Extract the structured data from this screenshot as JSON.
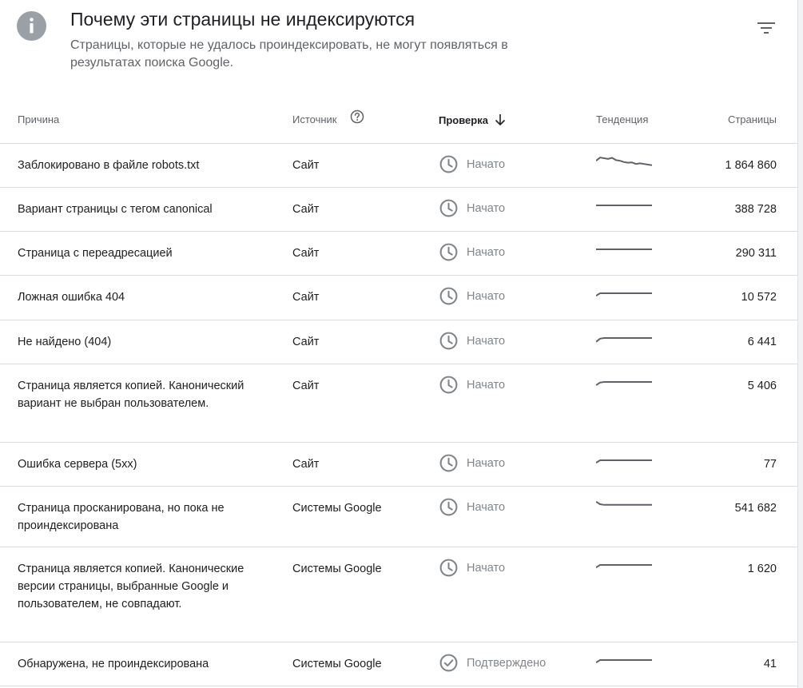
{
  "header": {
    "title": "Почему эти страницы не индексируются",
    "subtitle": "Страницы, которые не удалось проиндексировать, не могут появляться в результатах поиска Google.",
    "info_icon": "info-icon",
    "filter_icon": "filter-icon"
  },
  "columns": {
    "reason": "Причина",
    "source": "Источник",
    "check": "Проверка",
    "trend": "Тенденция",
    "pages": "Страницы"
  },
  "status_icons": {
    "started": "clock-icon",
    "confirmed": "check-circle-icon"
  },
  "colors": {
    "icon_grey": "#9aa0a6",
    "status_text": "#80868b",
    "sparkline": "#5f6368",
    "divider": "#dadce0"
  },
  "rows": [
    {
      "reason": "Заблокировано в файле robots.txt",
      "source": "Сайт",
      "check": "Начато",
      "status": "started",
      "pages": "1 864 860",
      "trend": [
        0.55,
        0.8,
        0.75,
        0.7,
        0.78,
        0.6,
        0.55,
        0.45,
        0.4,
        0.42,
        0.3,
        0.35,
        0.3,
        0.25,
        0.2
      ]
    },
    {
      "reason": "Вариант страницы с тегом canonical",
      "source": "Сайт",
      "check": "Начато",
      "status": "started",
      "pages": "388 728",
      "trend": [
        0.5,
        0.5,
        0.5,
        0.5,
        0.5,
        0.5,
        0.5,
        0.5,
        0.5,
        0.5,
        0.5,
        0.5,
        0.5,
        0.5,
        0.5
      ]
    },
    {
      "reason": "Страница с переадресацией",
      "source": "Сайт",
      "check": "Начато",
      "status": "started",
      "pages": "290 311",
      "trend": [
        0.5,
        0.5,
        0.5,
        0.5,
        0.5,
        0.5,
        0.5,
        0.5,
        0.5,
        0.5,
        0.5,
        0.5,
        0.5,
        0.5,
        0.5
      ]
    },
    {
      "reason": "Ложная ошибка 404",
      "source": "Сайт",
      "check": "Начато",
      "status": "started",
      "pages": "10 572",
      "trend": [
        0.3,
        0.5,
        0.5,
        0.5,
        0.5,
        0.5,
        0.5,
        0.5,
        0.5,
        0.5,
        0.5,
        0.5,
        0.5,
        0.5,
        0.5
      ]
    },
    {
      "reason": "Не найдено (404)",
      "source": "Сайт",
      "check": "Начато",
      "status": "started",
      "pages": "6 441",
      "trend": [
        0.2,
        0.45,
        0.5,
        0.5,
        0.5,
        0.5,
        0.5,
        0.5,
        0.5,
        0.5,
        0.5,
        0.5,
        0.5,
        0.5,
        0.5
      ]
    },
    {
      "reason": "Страница является копией. Канонический вариант не выбран пользователем.",
      "source": "Сайт",
      "check": "Начато",
      "status": "started",
      "pages": "5 406",
      "trend": [
        0.25,
        0.45,
        0.5,
        0.5,
        0.5,
        0.5,
        0.5,
        0.5,
        0.5,
        0.5,
        0.5,
        0.5,
        0.5,
        0.5,
        0.5
      ]
    },
    {
      "reason": "Ошибка сервера (5xx)",
      "source": "Сайт",
      "check": "Начато",
      "status": "started",
      "pages": "77",
      "trend": [
        0.3,
        0.5,
        0.5,
        0.5,
        0.5,
        0.5,
        0.5,
        0.5,
        0.5,
        0.5,
        0.5,
        0.5,
        0.5,
        0.5,
        0.5
      ]
    },
    {
      "reason": "Страница просканирована, но пока не проиндексирована",
      "source": "Системы Google",
      "check": "Начато",
      "status": "started",
      "pages": "541 682",
      "trend": [
        0.7,
        0.5,
        0.45,
        0.45,
        0.45,
        0.45,
        0.45,
        0.45,
        0.45,
        0.45,
        0.45,
        0.45,
        0.45,
        0.45,
        0.45
      ]
    },
    {
      "reason": "Страница является копией. Канонические версии страницы, выбранные Google и пользователем, не совпадают.",
      "source": "Системы Google",
      "check": "Начато",
      "status": "started",
      "pages": "1 620",
      "trend": [
        0.3,
        0.5,
        0.5,
        0.5,
        0.5,
        0.5,
        0.5,
        0.5,
        0.5,
        0.5,
        0.5,
        0.5,
        0.5,
        0.5,
        0.5
      ]
    },
    {
      "reason": "Обнаружена, не проиндексирована",
      "source": "Системы Google",
      "check": "Подтверждено",
      "status": "confirmed",
      "pages": "41",
      "trend": [
        0.3,
        0.5,
        0.5,
        0.5,
        0.5,
        0.5,
        0.5,
        0.5,
        0.5,
        0.5,
        0.5,
        0.5,
        0.5,
        0.5,
        0.5
      ]
    }
  ]
}
